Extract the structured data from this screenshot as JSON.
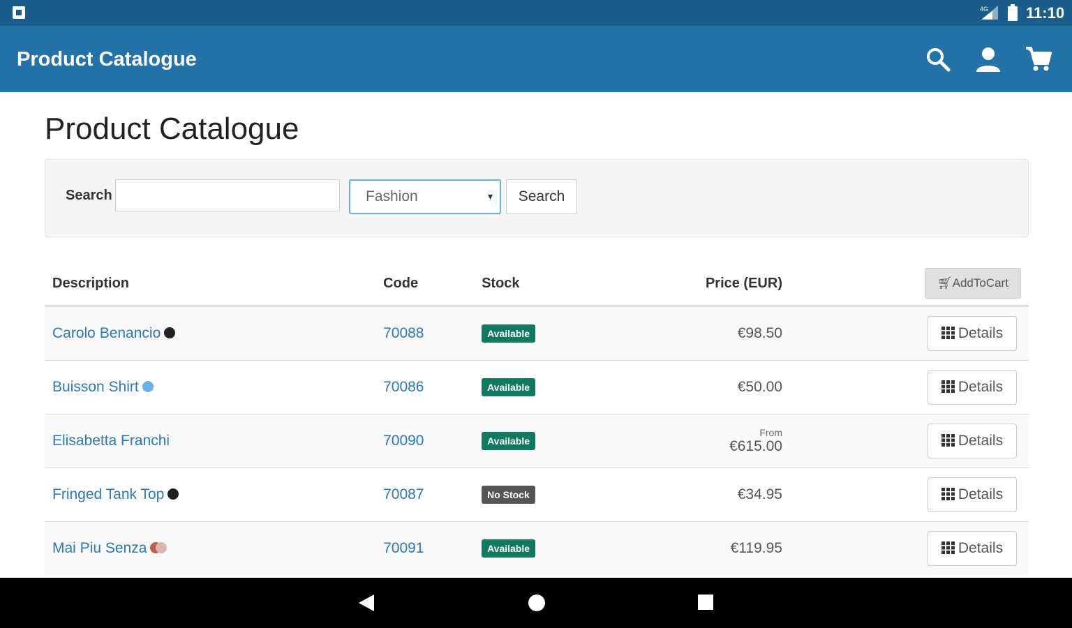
{
  "status_bar": {
    "time": "11:10"
  },
  "app_bar": {
    "title": "Product Catalogue"
  },
  "page": {
    "title": "Product Catalogue"
  },
  "search": {
    "label": "Search",
    "input_value": "",
    "category_selected": "Fashion",
    "button_label": "Search"
  },
  "table": {
    "headers": {
      "description": "Description",
      "code": "Code",
      "stock": "Stock",
      "price": "Price (EUR)",
      "action": "AddToCart"
    },
    "rows": [
      {
        "description": "Carolo Benancio",
        "dots": [
          "#222222"
        ],
        "code": "70088",
        "stock": "Available",
        "stock_color": "#0f7a5e",
        "price_prefix": "",
        "price": "€98.50",
        "action": "Details"
      },
      {
        "description": "Buisson Shirt",
        "dots": [
          "#6bb0e6"
        ],
        "code": "70086",
        "stock": "Available",
        "stock_color": "#0f7a5e",
        "price_prefix": "",
        "price": "€50.00",
        "action": "Details"
      },
      {
        "description": "Elisabetta Franchi",
        "dots": [],
        "code": "70090",
        "stock": "Available",
        "stock_color": "#0f7a5e",
        "price_prefix": "From",
        "price": "€615.00",
        "action": "Details"
      },
      {
        "description": "Fringed Tank Top",
        "dots": [
          "#222222"
        ],
        "code": "70087",
        "stock": "No Stock",
        "stock_color": "#555555",
        "price_prefix": "",
        "price": "€34.95",
        "action": "Details"
      },
      {
        "description": "Mai Piu Senza",
        "dots": [
          "#c85a4a",
          "#d8b8b0"
        ],
        "code": "70091",
        "stock": "Available",
        "stock_color": "#0f7a5e",
        "price_prefix": "",
        "price": "€119.95",
        "action": "Details"
      }
    ]
  },
  "icons": {
    "search": "search-icon",
    "account": "account-icon",
    "cart": "cart-icon",
    "grid": "grid-icon"
  },
  "colors": {
    "status_bar": "#1a5c8a",
    "app_bar": "#2473a8",
    "link": "#2a78b8",
    "available": "#0f7a5e",
    "no_stock": "#555555"
  }
}
